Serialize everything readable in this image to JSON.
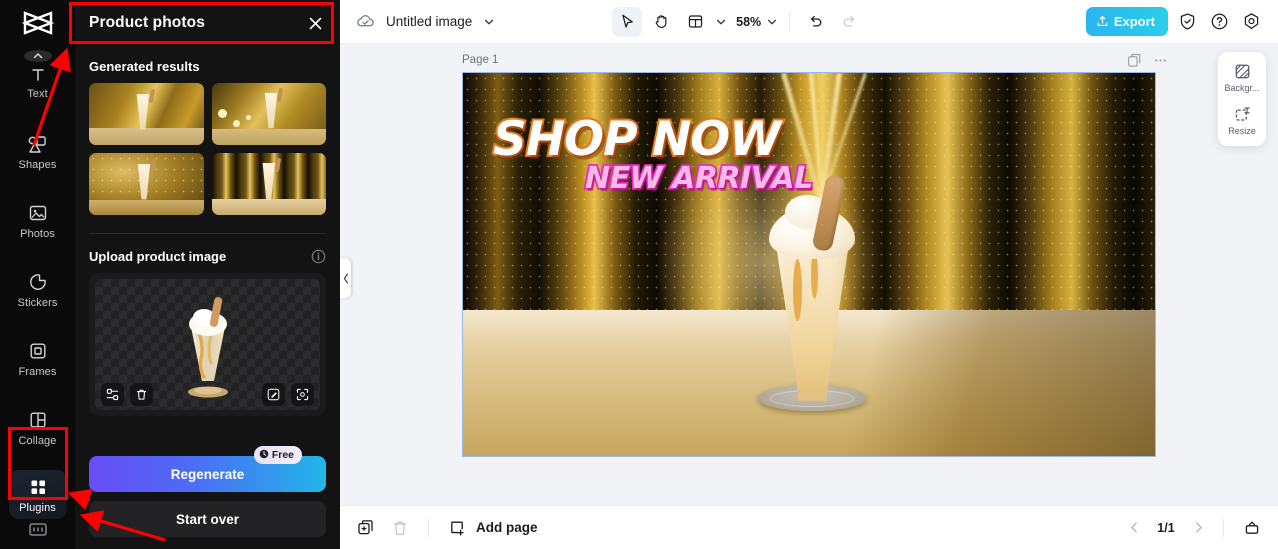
{
  "sidebar": {
    "logo_icon": "capcut-logo-icon",
    "scroll_up_icon": "chevron-up-icon",
    "items": [
      {
        "label": "Text",
        "icon": "text-icon"
      },
      {
        "label": "Shapes",
        "icon": "shapes-icon"
      },
      {
        "label": "Photos",
        "icon": "photos-icon"
      },
      {
        "label": "Stickers",
        "icon": "stickers-icon"
      },
      {
        "label": "Frames",
        "icon": "frames-icon"
      },
      {
        "label": "Collage",
        "icon": "collage-icon"
      },
      {
        "label": "Plugins",
        "icon": "plugins-icon",
        "active": true
      }
    ],
    "bottom_icon": "keyboard-icon"
  },
  "panel": {
    "title": "Product photos",
    "close_icon": "close-icon",
    "generated": {
      "title": "Generated results",
      "count": 4
    },
    "upload": {
      "title": "Upload product image",
      "info_icon": "info-icon",
      "tools_left": [
        "crop-icon",
        "trash-icon"
      ],
      "tools_right": [
        "magic-erase-icon",
        "expand-icon"
      ]
    },
    "regenerate_label": "Regenerate",
    "free_badge": "Free",
    "free_badge_icon": "clock-icon",
    "start_over_label": "Start over",
    "collapse_icon": "chevron-left-icon"
  },
  "topbar": {
    "cloud_icon": "cloud-saved-icon",
    "doc_title": "Untitled image",
    "doc_caret_icon": "chevron-down-icon",
    "tools": [
      {
        "name": "select-tool",
        "icon": "cursor-icon",
        "selected": true
      },
      {
        "name": "hand-tool",
        "icon": "hand-icon",
        "selected": false
      },
      {
        "name": "layout-tool",
        "icon": "layout-icon",
        "selected": false
      }
    ],
    "layout_caret_icon": "chevron-down-icon",
    "zoom": "58%",
    "zoom_caret_icon": "chevron-down-icon",
    "undo_icon": "undo-icon",
    "redo_icon": "redo-icon",
    "export_label": "Export",
    "export_icon": "upload-icon",
    "right_icons": [
      "shield-icon",
      "help-icon",
      "settings-icon"
    ],
    "accent_export": "#2ab4ef"
  },
  "canvas": {
    "page_label": "Page 1",
    "duplicate_icon": "duplicate-page-icon",
    "more_icon": "more-horizontal-icon",
    "artboard": {
      "headline": "SHOP NOW",
      "subheadline": "NEW ARRIVAL",
      "headline_color": "#ffffff",
      "headline_outline": "#e8771f",
      "subheadline_color": "#fbb9e8",
      "subheadline_outline": "#ee25c0"
    }
  },
  "float_panel": {
    "items": [
      {
        "label": "Backgr...",
        "icon": "background-icon"
      },
      {
        "label": "Resize",
        "icon": "resize-icon"
      }
    ]
  },
  "bottombar": {
    "duplicate_icon": "duplicate-icon",
    "delete_icon": "trash-icon",
    "add_page_label": "Add page",
    "add_page_icon": "add-page-icon",
    "prev_icon": "chevron-left-icon",
    "page_indicator": "1/1",
    "next_icon": "chevron-right-icon",
    "timeline_icon": "timeline-icon"
  },
  "annotations": {
    "highlight_color": "#ff0000",
    "boxes": [
      {
        "name": "panel-header-highlight"
      },
      {
        "name": "plugins-item-highlight"
      }
    ],
    "arrows": [
      {
        "name": "arrow-to-panel-header"
      },
      {
        "name": "arrow-to-start-over"
      },
      {
        "name": "arrow-to-plugins"
      }
    ]
  }
}
